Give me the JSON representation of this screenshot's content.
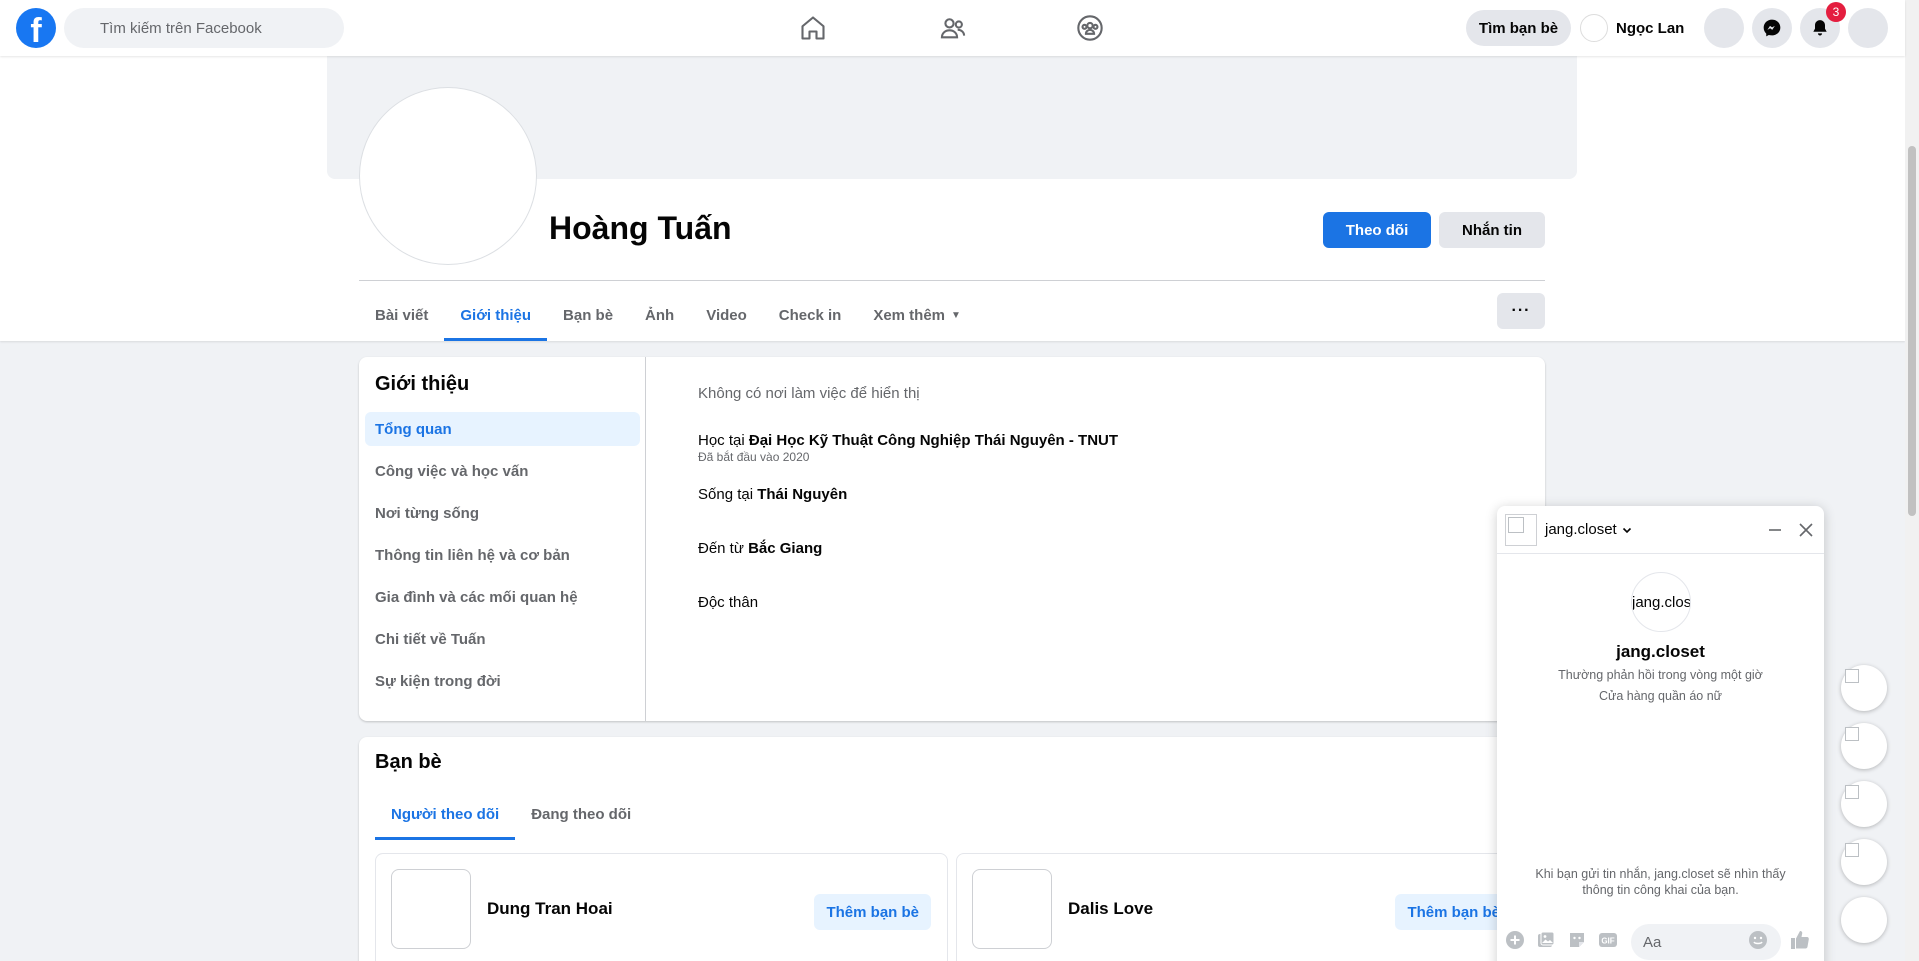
{
  "topbar": {
    "logo_letter": "f",
    "search_placeholder": "Tìm kiếm trên Facebook",
    "find_friends": "Tìm bạn bè",
    "user_name": "Ngọc Lan",
    "notification_count": "3"
  },
  "profile": {
    "name": "Hoàng Tuấn",
    "follow": "Theo dõi",
    "message": "Nhắn tin",
    "more": "···",
    "tabs": [
      "Bài viết",
      "Giới thiệu",
      "Bạn bè",
      "Ảnh",
      "Video",
      "Check in",
      "Xem thêm"
    ],
    "active_tab": "Giới thiệu"
  },
  "intro": {
    "title": "Giới thiệu",
    "menu": [
      "Tổng quan",
      "Công việc và học vấn",
      "Nơi từng sống",
      "Thông tin liên hệ và cơ bản",
      "Gia đình và các mối quan hệ",
      "Chi tiết về Tuấn",
      "Sự kiện trong đời"
    ],
    "active_menu": "Tổng quan",
    "work_empty": "Không có nơi làm việc để hiển thị",
    "study_prefix": "Học tại",
    "study_place": "Đại Học Kỹ Thuật Công Nghiệp Thái Nguyên - TNUT",
    "study_since": "Đã bắt đầu vào 2020",
    "live_prefix": "Sống tại",
    "live_place": "Thái Nguyên",
    "from_prefix": "Đến từ",
    "from_place": "Bắc Giang",
    "relationship": "Độc thân"
  },
  "friends": {
    "title": "Bạn bè",
    "tabs": [
      "Người theo dõi",
      "Đang theo dõi"
    ],
    "people": [
      {
        "name": "Dung Tran Hoai",
        "action": "Thêm bạn bè"
      },
      {
        "name": "Dalis Love",
        "action": "Thêm bạn bè"
      }
    ]
  },
  "chat": {
    "name": "jang.closet",
    "avatar_text": "jang.clos",
    "response": "Thường phản hồi trong vòng một giờ",
    "category": "Cửa hàng quần áo nữ",
    "privacy_note": "Khi bạn gửi tin nhắn, jang.closet sẽ nhìn thấy thông tin công khai của bạn.",
    "input_placeholder": "Aa",
    "gif_label": "GIF"
  },
  "colors": {
    "brand": "#1877f2",
    "accent": "#1b74e4",
    "accent_light": "#e7f3ff",
    "badge": "#e41e3f",
    "page_bg": "#f0f2f5"
  },
  "icons": [
    "facebook-logo-icon",
    "search-icon",
    "home-icon",
    "friends-icon",
    "groups-icon",
    "messenger-icon",
    "bell-icon",
    "chevron-down-icon",
    "minimize-icon",
    "close-icon",
    "plus-circle-icon",
    "photo-icon",
    "sticker-icon",
    "gif-icon",
    "emoji-icon",
    "like-icon"
  ]
}
